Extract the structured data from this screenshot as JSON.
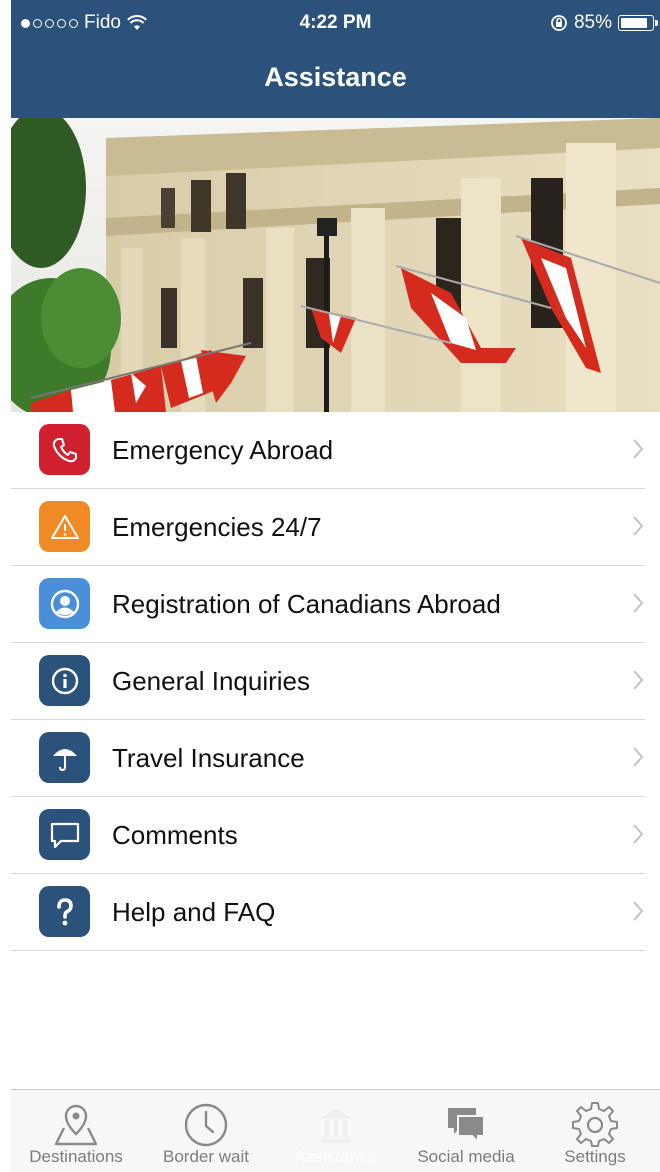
{
  "status_bar": {
    "carrier": "Fido",
    "time": "4:22 PM",
    "battery": "85%"
  },
  "nav": {
    "title": "Assistance"
  },
  "menu": [
    {
      "label": "Emergency Abroad",
      "icon": "phone-icon",
      "color": "#d0202e"
    },
    {
      "label": "Emergencies 24/7",
      "icon": "warning-icon",
      "color": "#f08a24"
    },
    {
      "label": "Registration of Canadians Abroad",
      "icon": "person-icon",
      "color": "#4a8fd8"
    },
    {
      "label": "General Inquiries",
      "icon": "info-icon",
      "color": "#2b527a"
    },
    {
      "label": "Travel Insurance",
      "icon": "umbrella-icon",
      "color": "#2b527a"
    },
    {
      "label": "Comments",
      "icon": "comment-icon",
      "color": "#2b527a"
    },
    {
      "label": "Help and FAQ",
      "icon": "question-icon",
      "color": "#2b527a"
    }
  ],
  "tabs": [
    {
      "label": "Destinations",
      "icon": "map-pin-icon"
    },
    {
      "label": "Border wait",
      "icon": "clock-icon"
    },
    {
      "label": "Assistance",
      "icon": "building-icon",
      "active": true
    },
    {
      "label": "Social media",
      "icon": "chat-icon"
    },
    {
      "label": "Settings",
      "icon": "gear-icon"
    }
  ],
  "colors": {
    "nav_bar": "#2b527a",
    "tab_inactive": "#7c7c7c"
  }
}
